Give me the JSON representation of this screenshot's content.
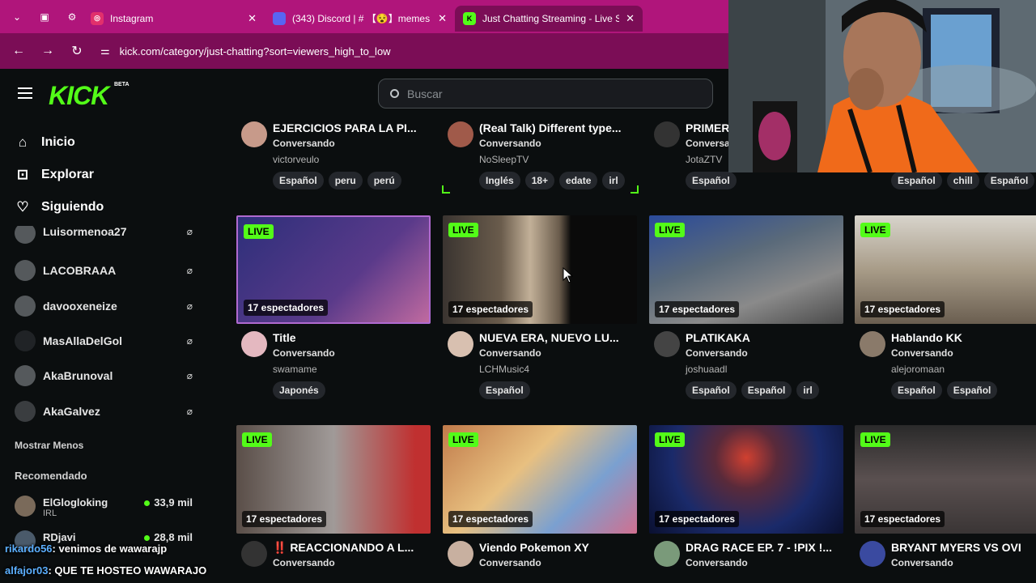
{
  "browser": {
    "tabs": [
      {
        "title": "Instagram",
        "icon": "instagram-icon",
        "color": "#e1306c"
      },
      {
        "title": "(343) Discord | # 【😵】memes",
        "icon": "discord-icon",
        "color": "#5865f2",
        "badge": "343"
      },
      {
        "title": "Just Chatting Streaming - Live S",
        "icon": "kick-icon",
        "color": "#53fc18"
      }
    ],
    "url": "kick.com/category/just-chatting?sort=viewers_high_to_low"
  },
  "header": {
    "logo": "KICK",
    "beta": "BETA",
    "search_placeholder": "Buscar"
  },
  "sidebar": {
    "nav": [
      {
        "label": "Inicio",
        "icon": "home-icon"
      },
      {
        "label": "Explorar",
        "icon": "explore-icon"
      },
      {
        "label": "Siguiendo",
        "icon": "heart-icon"
      }
    ],
    "following": [
      {
        "name": "Luisormenoa27"
      },
      {
        "name": "LACOBRAAA"
      },
      {
        "name": "davooxeneize"
      },
      {
        "name": "MasAllaDelGol"
      },
      {
        "name": "AkaBrunoval"
      },
      {
        "name": "AkaGalvez"
      }
    ],
    "show_less": "Mostrar Menos",
    "recommended_label": "Recomendado",
    "recommended": [
      {
        "name": "ElGlogloking",
        "category": "IRL",
        "viewers": "33,9 mil"
      },
      {
        "name": "RDjavi",
        "category": "",
        "viewers": "28,8 mil"
      }
    ]
  },
  "streams_top": [
    {
      "title": "EJERCICIOS PARA LA PI...",
      "category": "Conversando",
      "user": "victorveulo",
      "tags": [
        "Español",
        "peru",
        "perú"
      ]
    },
    {
      "title": "(Real Talk) Different type...",
      "category": "Conversando",
      "user": "NoSleepTV",
      "tags": [
        "Inglés",
        "18+",
        "edate",
        "irl"
      ]
    },
    {
      "title": "PRIMER",
      "category": "Conversa",
      "user": "JotaZTV",
      "tags": [
        "Español"
      ]
    },
    {
      "title": "",
      "category": "",
      "user": "",
      "tags": [
        "Español",
        "chill",
        "Español"
      ]
    }
  ],
  "streams_mid": [
    {
      "live": "LIVE",
      "viewers": "17 espectadores",
      "title": "Title",
      "category": "Conversando",
      "user": "swamame",
      "tags": [
        "Japonés"
      ],
      "thumb": "#3a3f8c"
    },
    {
      "live": "LIVE",
      "viewers": "17 espectadores",
      "title": "NUEVA ERA, NUEVO LU...",
      "category": "Conversando",
      "user": "LCHMusic4",
      "tags": [
        "Español"
      ],
      "thumb": "#5a4a3a"
    },
    {
      "live": "LIVE",
      "viewers": "17 espectadores",
      "title": "PLATIKAKA",
      "category": "Conversando",
      "user": "joshuaadl",
      "tags": [
        "Español",
        "Español",
        "irl"
      ],
      "thumb": "#4a5566"
    },
    {
      "live": "LIVE",
      "viewers": "17 espectadores",
      "title": "Hablando KK",
      "category": "Conversando",
      "user": "alejoromaan",
      "tags": [
        "Español",
        "Español"
      ],
      "thumb": "#8a8272"
    }
  ],
  "streams_bottom": [
    {
      "live": "LIVE",
      "viewers": "17 espectadores",
      "title": "‼️ REACCIONANDO A L...",
      "category": "Conversando",
      "thumb": "#6a5a52"
    },
    {
      "live": "LIVE",
      "viewers": "17 espectadores",
      "title": "Viendo Pokemon XY",
      "category": "Conversando",
      "thumb": "#b87a4a"
    },
    {
      "live": "LIVE",
      "viewers": "17 espectadores",
      "title": "DRAG RACE EP. 7 - !PIX !...",
      "category": "Conversando",
      "thumb": "#1a2a5a"
    },
    {
      "live": "LIVE",
      "viewers": "17 espectadores",
      "title": "BRYANT MYERS VS OVI",
      "category": "Conversando",
      "thumb": "#3a3a3a"
    }
  ],
  "chat_overlay": [
    {
      "user": "rikardo56",
      "message": ": venimos de wawarajp"
    },
    {
      "user": "alfajor03",
      "message": ": QUE TE HOSTEO WAWARAJO"
    }
  ],
  "colors": {
    "accent": "#53fc18",
    "tabbar": "#b0157b",
    "addrbar": "#7b0d56",
    "background": "#0b0e0f"
  }
}
